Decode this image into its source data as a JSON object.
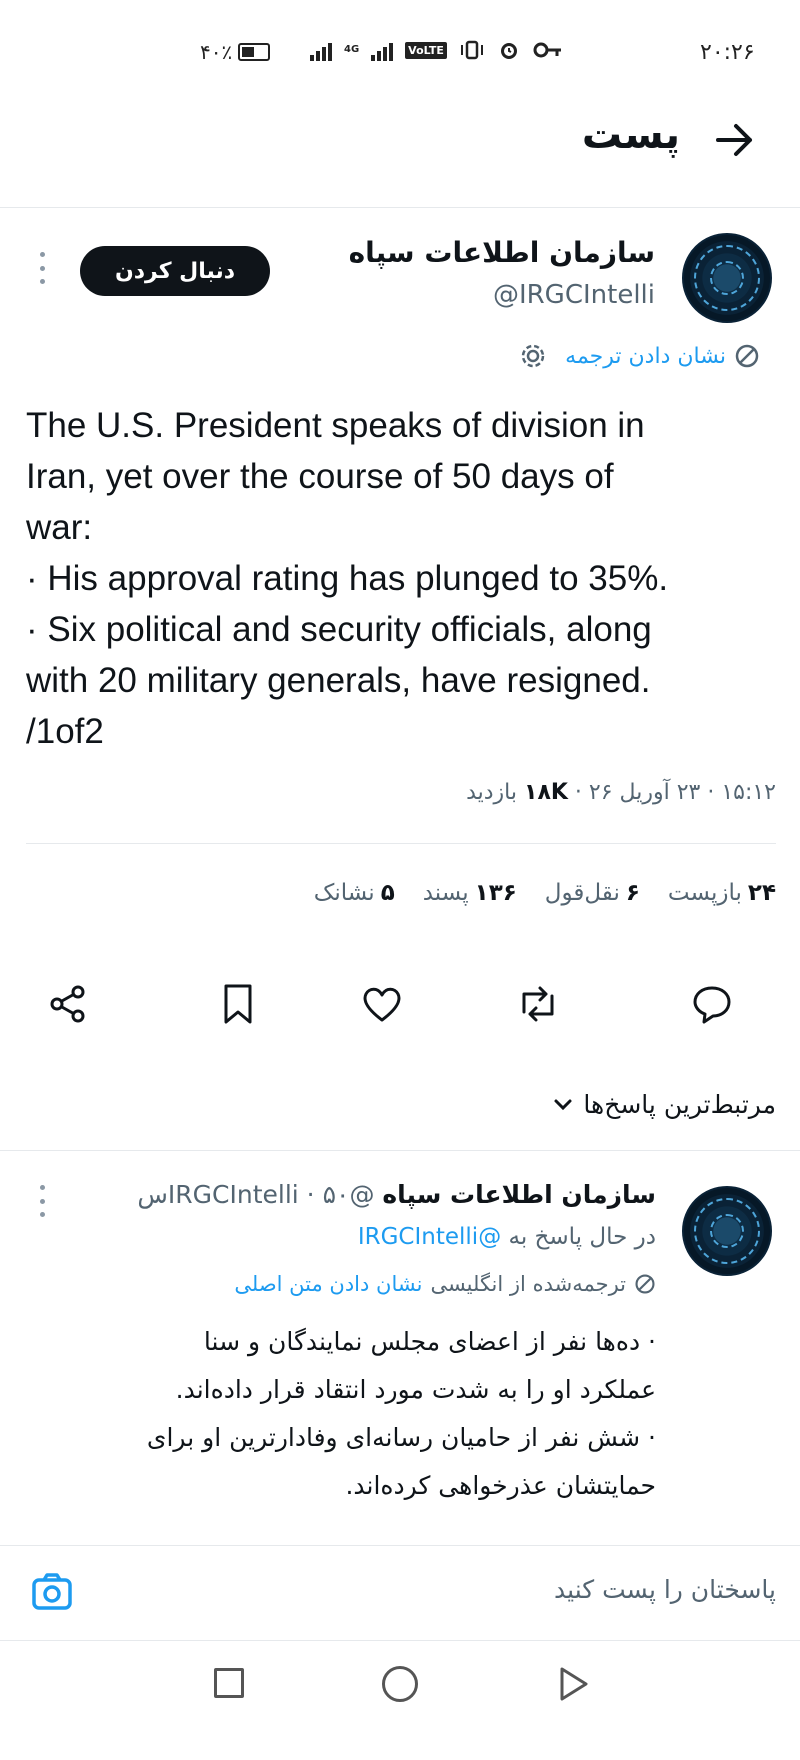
{
  "status_bar": {
    "time": "۲۰:۲۶",
    "battery": "۴۰٪",
    "network": "4G",
    "volte": "VoLTE"
  },
  "header": {
    "title": "پست"
  },
  "tweet": {
    "author_name": "سازمان اطلاعات سپاه",
    "author_handle": "@IRGCIntelli",
    "follow_label": "دنبال کردن",
    "translate_label": "نشان دادن ترجمه",
    "text": "The U.S. President speaks of division in\nIran, yet over the course of 50 days of\nwar:\n· His approval rating has plunged to 35%.\n· Six political and security officials, along\nwith 20 military generals, have resigned.\n/1of2",
    "timestamp": "۱۵:۱۲ · ۲۳ آوریل ۲۶ · ",
    "views_count": "۱۸K",
    "views_label": " بازدید"
  },
  "stats": {
    "reposts_count": "۲۴",
    "reposts_label": "بازپست",
    "quotes_count": "۶",
    "quotes_label": "نقل‌قول",
    "likes_count": "۱۳۶",
    "likes_label": "پسند",
    "bookmarks_count": "۵",
    "bookmarks_label": "نشانک"
  },
  "actions": [
    "reply-icon",
    "repost-icon",
    "like-icon",
    "bookmark-icon",
    "share-icon"
  ],
  "replies_sort": {
    "label": "مرتبط‌ترین پاسخ‌ها"
  },
  "reply": {
    "author_name": "سازمان اطلاعات سپاه",
    "author_meta": " @IRGCIntelli · ۵۰س",
    "replying_to_label": "در حال پاسخ به ",
    "replying_to_handle": "@IRGCIntelli",
    "translated_from": "ترجمه‌شده از انگلیسی",
    "show_original": "نشان دادن متن اصلی",
    "text_line1": "· ده‌ها نفر از اعضای مجلس نمایندگان و سنا",
    "text_line2": "عملکرد او را به شدت مورد انتقاد قرار داده‌اند.",
    "text_line3": "· شش نفر از حامیان رسانه‌ای وفادارترین او برای",
    "text_line4": "حمایتشان عذرخواهی کرده‌اند."
  },
  "compose": {
    "placeholder": "پاسختان را پست کنید"
  },
  "colors": {
    "accent": "#1d9bf0",
    "text": "#0f1419",
    "muted": "#536471",
    "divider": "#e6e9ec"
  }
}
